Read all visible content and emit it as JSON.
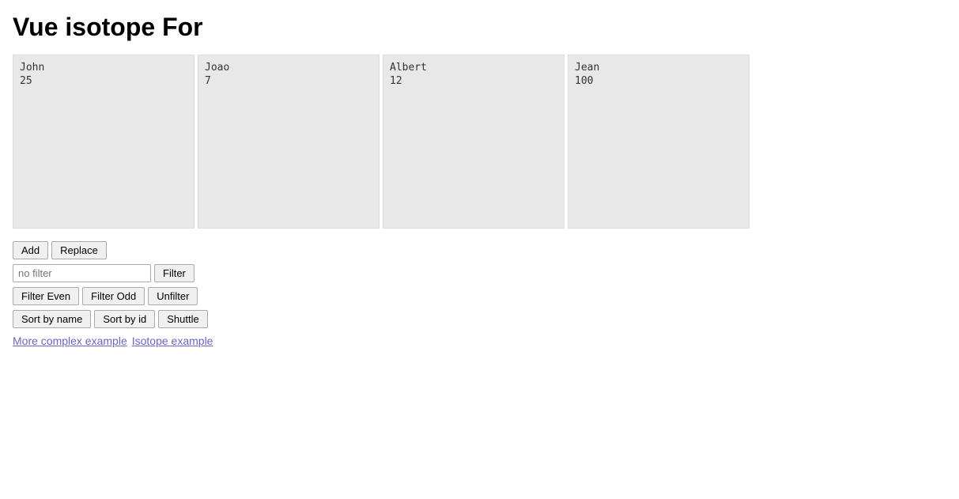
{
  "page": {
    "title": "Vue isotope For"
  },
  "cards": [
    {
      "name": "John",
      "id": "25"
    },
    {
      "name": "Joao",
      "id": "7"
    },
    {
      "name": "Albert",
      "id": "12"
    },
    {
      "name": "Jean",
      "id": "100"
    }
  ],
  "controls": {
    "add_label": "Add",
    "replace_label": "Replace",
    "filter_input_placeholder": "no filter",
    "filter_button_label": "Filter",
    "filter_even_label": "Filter Even",
    "filter_odd_label": "Filter Odd",
    "unfilter_label": "Unfilter",
    "sort_by_name_label": "Sort by name",
    "sort_by_id_label": "Sort by id",
    "shuttle_label": "Shuttle"
  },
  "links": [
    {
      "label": "More complex example",
      "href": "#"
    },
    {
      "label": "Isotope example",
      "href": "#"
    }
  ]
}
